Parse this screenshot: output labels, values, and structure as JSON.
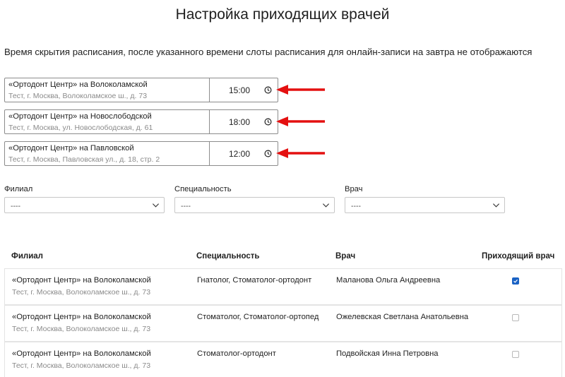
{
  "page": {
    "title": "Настройка приходящих врачей",
    "description": "Время скрытия расписания, после указанного времени слоты расписания для онлайн-записи на завтра не отображаются"
  },
  "schedule_hide_times": [
    {
      "branch": "«Ортодонт Центр» на Волоколамской",
      "address": "Тест, г. Москва, Волоколамское ш., д. 73",
      "time": "15:00"
    },
    {
      "branch": "«Ортодонт Центр» на Новослободской",
      "address": "Тест, г. Москва, ул. Новослободская, д. 61",
      "time": "18:00"
    },
    {
      "branch": "«Ортодонт Центр» на Павловской",
      "address": "Тест, г. Москва, Павловская ул., д. 18, стр. 2",
      "time": "12:00"
    }
  ],
  "filters": {
    "branch": {
      "label": "Филиал",
      "value": "----"
    },
    "specialty": {
      "label": "Специальность",
      "value": "----"
    },
    "doctor": {
      "label": "Врач",
      "value": "----"
    }
  },
  "table": {
    "columns": {
      "branch": "Филиал",
      "specialty": "Специальность",
      "doctor": "Врач",
      "visiting": "Приходящий врач"
    },
    "rows": [
      {
        "branch": "«Ортодонт Центр» на Волоколамской",
        "address": "Тест, г. Москва, Волоколамское ш., д. 73",
        "specialty": "Гнатолог, Стоматолог-ортодонт",
        "doctor": "Маланова Ольга Андреевна",
        "visiting": true
      },
      {
        "branch": "«Ортодонт Центр» на Волоколамской",
        "address": "Тест, г. Москва, Волоколамское ш., д. 73",
        "specialty": "Стоматолог, Стоматолог-ортопед",
        "doctor": "Ожелевская Светлана Анатольевна",
        "visiting": false
      },
      {
        "branch": "«Ортодонт Центр» на Волоколамской",
        "address": "Тест, г. Москва, Волоколамское ш., д. 73",
        "specialty": "Стоматолог-ортодонт",
        "doctor": "Подвойская Инна Петровна",
        "visiting": false
      }
    ]
  },
  "colors": {
    "arrow": "#e41010",
    "checkbox_checked": "#1a62c4",
    "border": "#8c8c8c"
  },
  "icons": {
    "time": "clock-icon",
    "dropdown": "chevron-down-icon",
    "annotation": "arrow-left-icon",
    "check": "check-icon"
  }
}
